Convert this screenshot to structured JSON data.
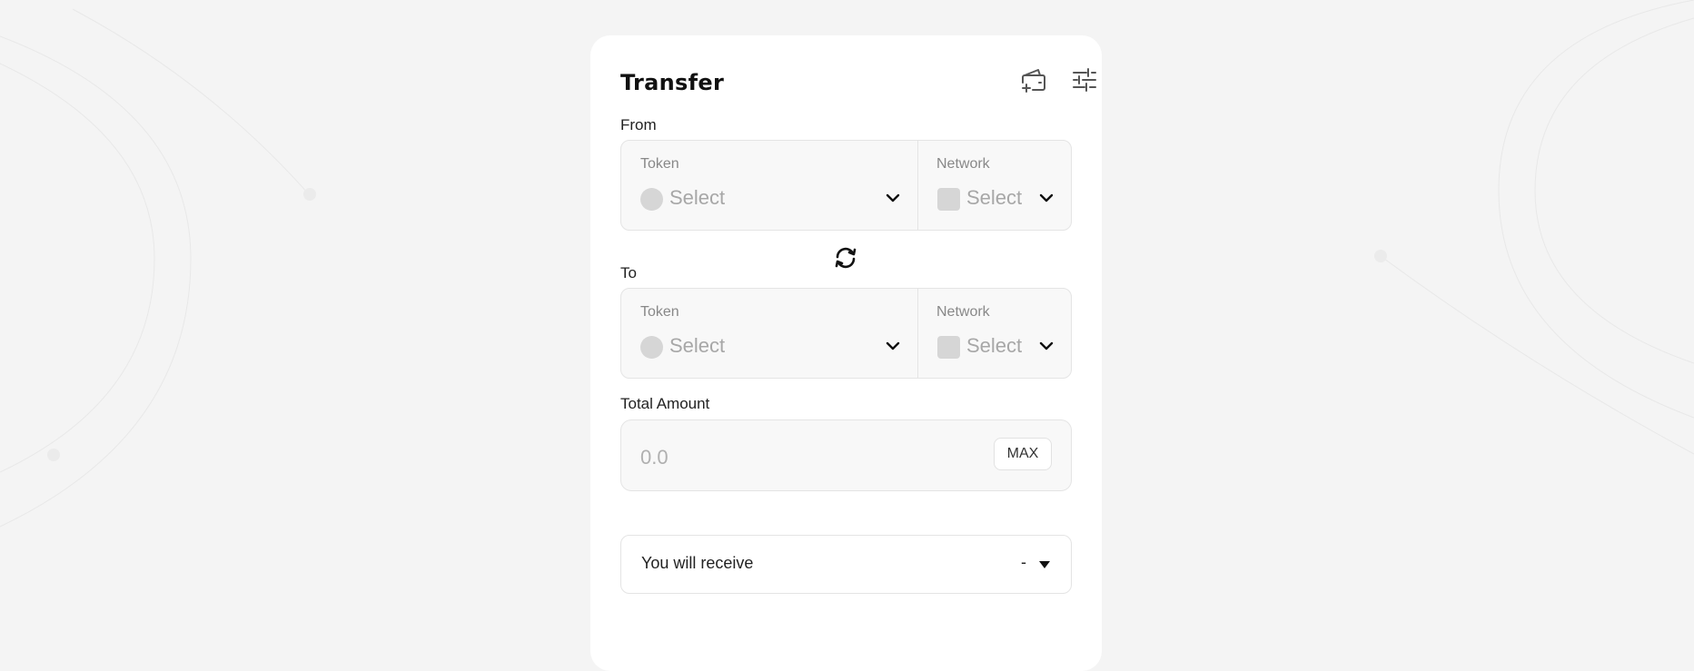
{
  "header": {
    "title": "Transfer",
    "icons": {
      "wallet": "wallet-add-icon",
      "settings": "sliders-icon"
    }
  },
  "from": {
    "section_label": "From",
    "token_label": "Token",
    "token_placeholder": "Select",
    "network_label": "Network",
    "network_placeholder": "Select"
  },
  "swap": {
    "icon": "swap-arrows-icon"
  },
  "to": {
    "section_label": "To",
    "token_label": "Token",
    "token_placeholder": "Select",
    "network_label": "Network",
    "network_placeholder": "Select"
  },
  "amount": {
    "label": "Total Amount",
    "placeholder": "0.0",
    "value": "",
    "max_label": "MAX"
  },
  "receive": {
    "label": "You will receive",
    "value": "-"
  },
  "colors": {
    "background": "#f4f4f4",
    "card": "#ffffff",
    "field_bg": "#f8f8f8",
    "placeholder": "#a7a7a7",
    "border": "#e4e4e4"
  }
}
